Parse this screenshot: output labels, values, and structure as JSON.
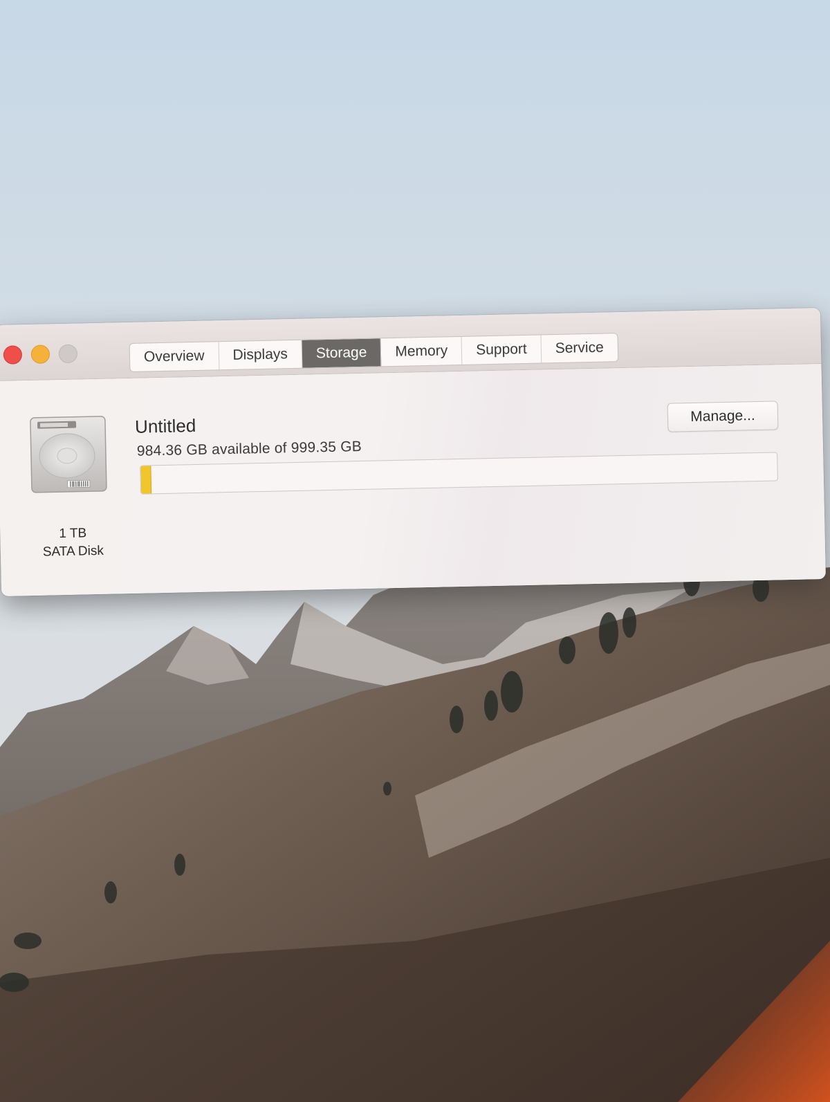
{
  "window": {
    "controls": [
      "close",
      "minimize",
      "zoom"
    ],
    "tabs": [
      {
        "label": "Overview",
        "active": false
      },
      {
        "label": "Displays",
        "active": false
      },
      {
        "label": "Storage",
        "active": true
      },
      {
        "label": "Memory",
        "active": false
      },
      {
        "label": "Support",
        "active": false
      },
      {
        "label": "Service",
        "active": false
      }
    ]
  },
  "storage": {
    "disk": {
      "icon": "hard-disk-icon",
      "capacity_label": "1 TB",
      "type_label": "SATA Disk"
    },
    "volume": {
      "name": "Untitled",
      "availability_text": "984.36 GB available of 999.35 GB",
      "used_fraction": 0.015
    },
    "manage_label": "Manage..."
  },
  "colors": {
    "used_storage": "#f1c52c",
    "active_tab": "#6b6866",
    "close": "#f04e4a",
    "minimize": "#f6b13a",
    "zoom_disabled": "#cfc9c7"
  }
}
